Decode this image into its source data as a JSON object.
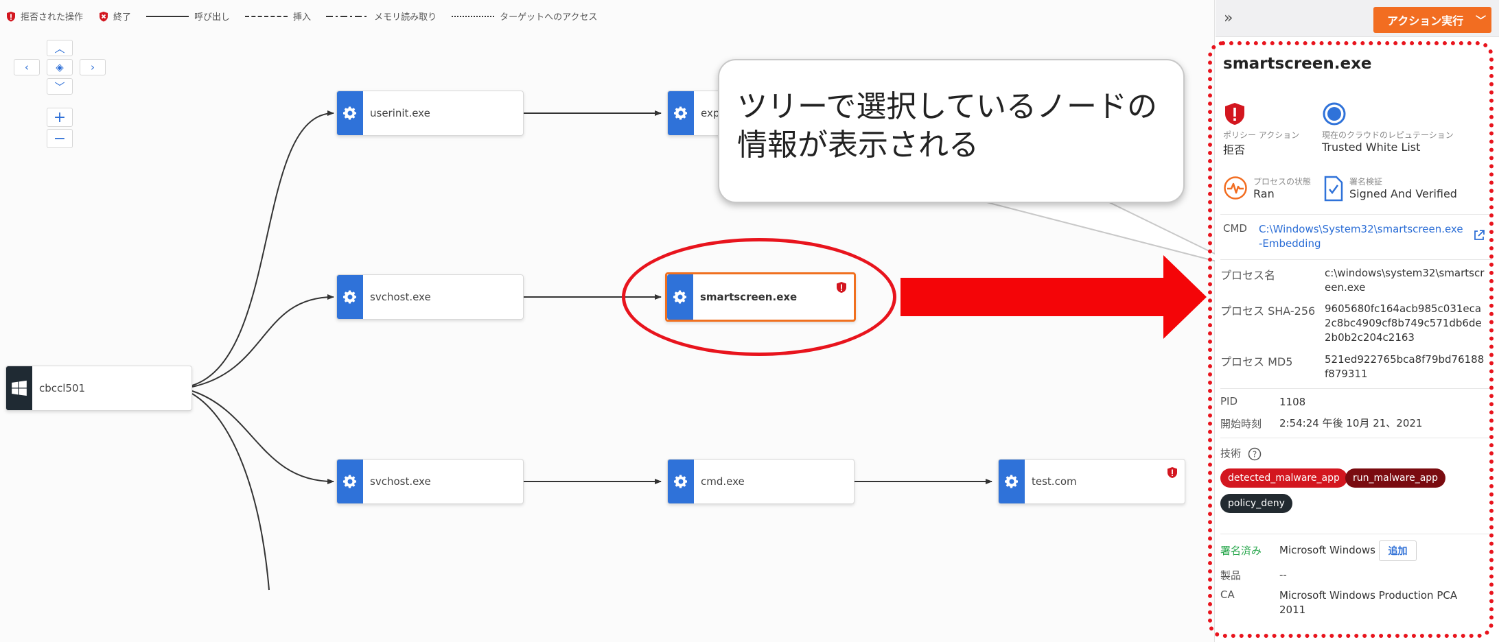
{
  "legend": {
    "denied": "拒否された操作",
    "terminated": "終了",
    "call": "呼び出し",
    "inject": "挿入",
    "memory_read": "メモリ読み取り",
    "target_access": "ターゲットへのアクセス"
  },
  "tree": {
    "root": "cbccl501",
    "nodes": {
      "userinit": "userinit.exe",
      "explorer": "exp",
      "svchost1": "svchost.exe",
      "smartscreen": "smartscreen.exe",
      "svchost2": "svchost.exe",
      "cmd": "cmd.exe",
      "test": "test.com"
    }
  },
  "callout": {
    "text": "ツリーで選択しているノードの情報が表示される"
  },
  "panel": {
    "action_button": "アクション実行",
    "title": "smartscreen.exe",
    "policy_action_label": "ポリシー アクション",
    "policy_action_value": "拒否",
    "reputation_label": "現在のクラウドのレピュテーション",
    "reputation_value": "Trusted White List",
    "process_state_label": "プロセスの状態",
    "process_state_value": "Ran",
    "signature_label": "署名検証",
    "signature_value": "Signed And Verified",
    "cmd_label": "CMD",
    "cmd_value": "C:\\Windows\\System32\\smartscreen.exe -Embedding",
    "process_name_label": "プロセス名",
    "process_name_value": "c:\\windows\\system32\\smartscreen.exe",
    "sha256_label": "プロセス SHA-256",
    "sha256_value": "9605680fc164acb985c031eca2c8bc4909cf8b749c571db6de2b0b2c204c2163",
    "md5_label": "プロセス MD5",
    "md5_value": "521ed922765bca8f79bd76188f879311",
    "pid_label": "PID",
    "pid_value": "1108",
    "start_label": "開始時刻",
    "start_value": "2:54:24 午後 10月 21、2021",
    "tech_label": "技術",
    "tags": [
      "detected_malware_app",
      "run_malware_app",
      "policy_deny"
    ],
    "signed_label": "署名済み",
    "signed_value": "Microsoft Windows",
    "add_label": "追加",
    "product_label": "製品",
    "product_value": "--",
    "ca_label": "CA",
    "ca_value": "Microsoft Windows Production PCA 2011"
  },
  "colors": {
    "accent_blue": "#2f72d9",
    "action_orange": "#f26d21",
    "annotation_red": "#e8141d",
    "tag_red": "#d3161f",
    "tag_darkred": "#7a0b10",
    "tag_dark": "#222a30",
    "signed_green": "#22a447"
  },
  "icons": {
    "process": "gear-icon",
    "root": "windows-icon",
    "denied": "shield-alert-icon",
    "terminated": "x-badge-icon",
    "reputation": "circle-icon",
    "state": "pulse-icon",
    "signature": "document-check-icon",
    "external": "external-link-icon",
    "help": "question-icon"
  }
}
